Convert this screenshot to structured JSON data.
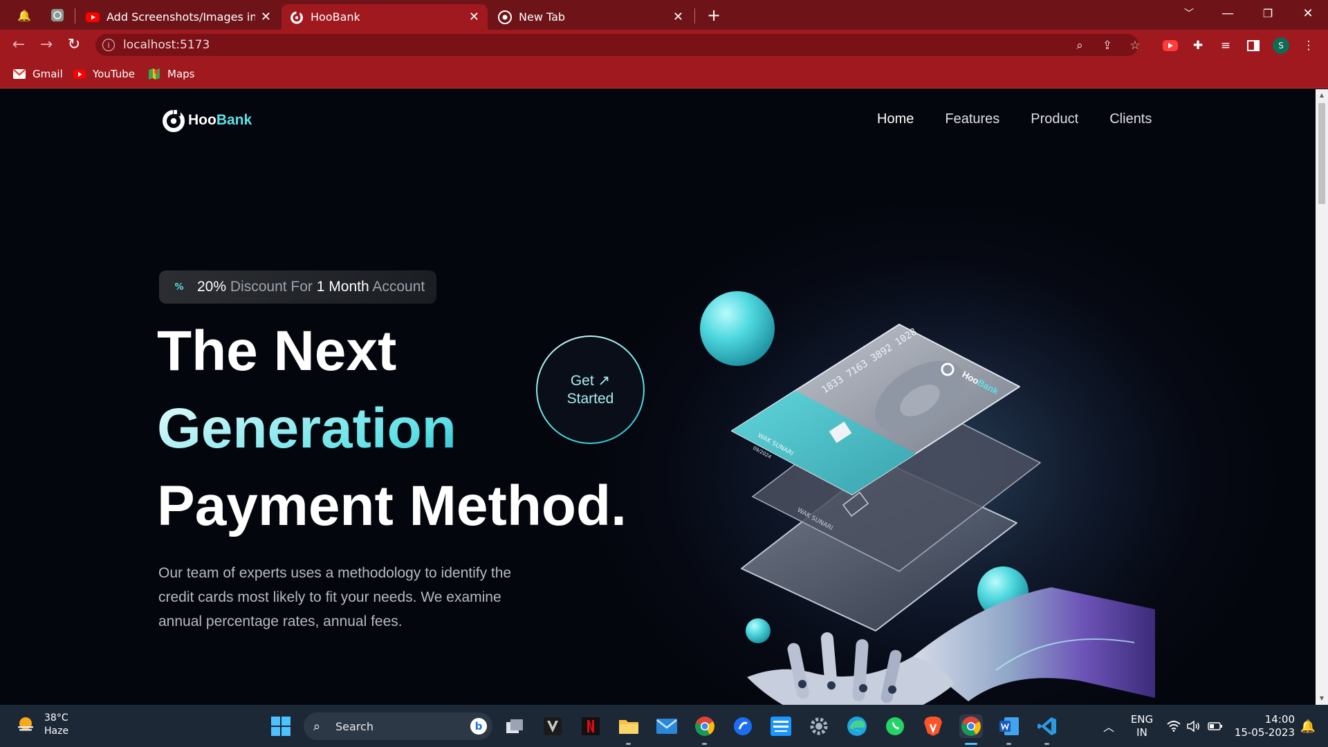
{
  "browser": {
    "tabs": [
      {
        "title": "Add Screenshots/Images in Githu",
        "favicon": "youtube-icon"
      },
      {
        "title": "HooBank",
        "favicon": "hoobank-icon",
        "active": true
      },
      {
        "title": "New Tab",
        "favicon": "chrome-icon"
      }
    ],
    "url": "localhost:5173",
    "profile_initial": "S",
    "bookmarks": [
      {
        "label": "Gmail",
        "icon": "gmail-icon"
      },
      {
        "label": "YouTube",
        "icon": "youtube-icon"
      },
      {
        "label": "Maps",
        "icon": "maps-icon"
      }
    ],
    "colors": {
      "frame": "#6e1419",
      "toolbar": "#a0191f"
    }
  },
  "site": {
    "logo": {
      "part1": "Hoo",
      "part2": "Bank"
    },
    "nav": [
      "Home",
      "Features",
      "Product",
      "Clients"
    ],
    "discount": {
      "value": "20%",
      "label1": "Discount For",
      "num": "1",
      "unit": "Month",
      "label2": "Account"
    },
    "headline": {
      "line1": "The Next",
      "line2": "Generation",
      "line3": "Payment Method."
    },
    "cta": {
      "line1": "Get",
      "line2": "Started"
    },
    "description": "Our team of experts uses a methodology to identify the credit cards most likely to fit your needs. We examine annual percentage rates, annual fees.",
    "card": {
      "number": "1833 7163 3892 1028",
      "holder": "WAK SUNARI",
      "expiry": "09/2024"
    },
    "colors": {
      "accent": "#5ce1e6",
      "background": "#00040f"
    }
  },
  "taskbar": {
    "weather": {
      "temp": "38°C",
      "condition": "Haze"
    },
    "search_label": "Search",
    "language": {
      "line1": "ENG",
      "line2": "IN"
    },
    "clock": {
      "time": "14:00",
      "date": "15-05-2023"
    }
  }
}
